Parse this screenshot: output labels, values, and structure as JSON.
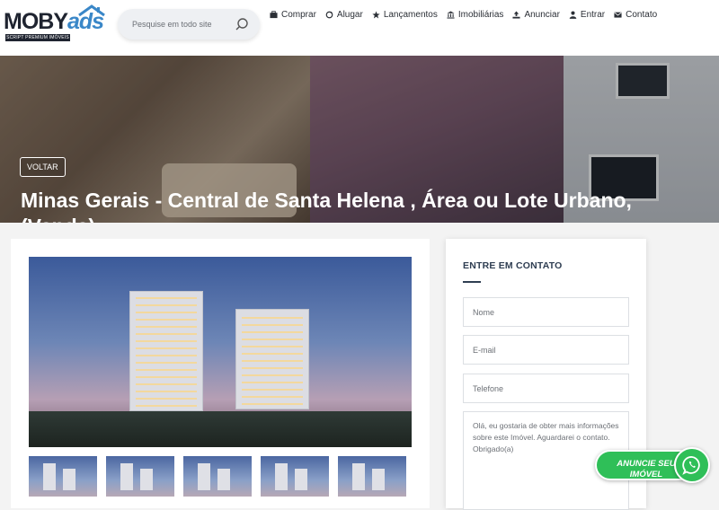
{
  "brand": {
    "name": "MOBY",
    "name_accent": "ads",
    "tagline": "SCRIPT PREMIUM IMÓVEIS"
  },
  "search": {
    "placeholder": "Pesquise em todo site"
  },
  "nav": [
    {
      "label": "Comprar",
      "icon": "briefcase-icon"
    },
    {
      "label": "Alugar",
      "icon": "refresh-icon"
    },
    {
      "label": "Lançamentos",
      "icon": "star-icon"
    },
    {
      "label": "Imobiliárias",
      "icon": "bank-icon"
    },
    {
      "label": "Anunciar",
      "icon": "upload-icon"
    },
    {
      "label": "Entrar",
      "icon": "user-icon"
    },
    {
      "label": "Contato",
      "icon": "envelope-icon"
    }
  ],
  "hero": {
    "back_label": "VOLTAR",
    "title": "Minas Gerais - Central de Santa Helena , Área ou Lote Urbano, (Venda)"
  },
  "contact": {
    "title": "ENTRE EM CONTATO",
    "name_placeholder": "Nome",
    "email_placeholder": "E-mail",
    "phone_placeholder": "Telefone",
    "message": "Olá, eu gostaria de obter mais informações sobre este Imóvel. Aguardarei o contato. Obrigado(a)"
  },
  "floating": {
    "label_line1": "ANUNCIE SEU",
    "label_line2": "IMÓVEL"
  },
  "colors": {
    "accent": "#3a87c8",
    "dark": "#2f3e52",
    "whatsapp": "#2fbf58"
  }
}
